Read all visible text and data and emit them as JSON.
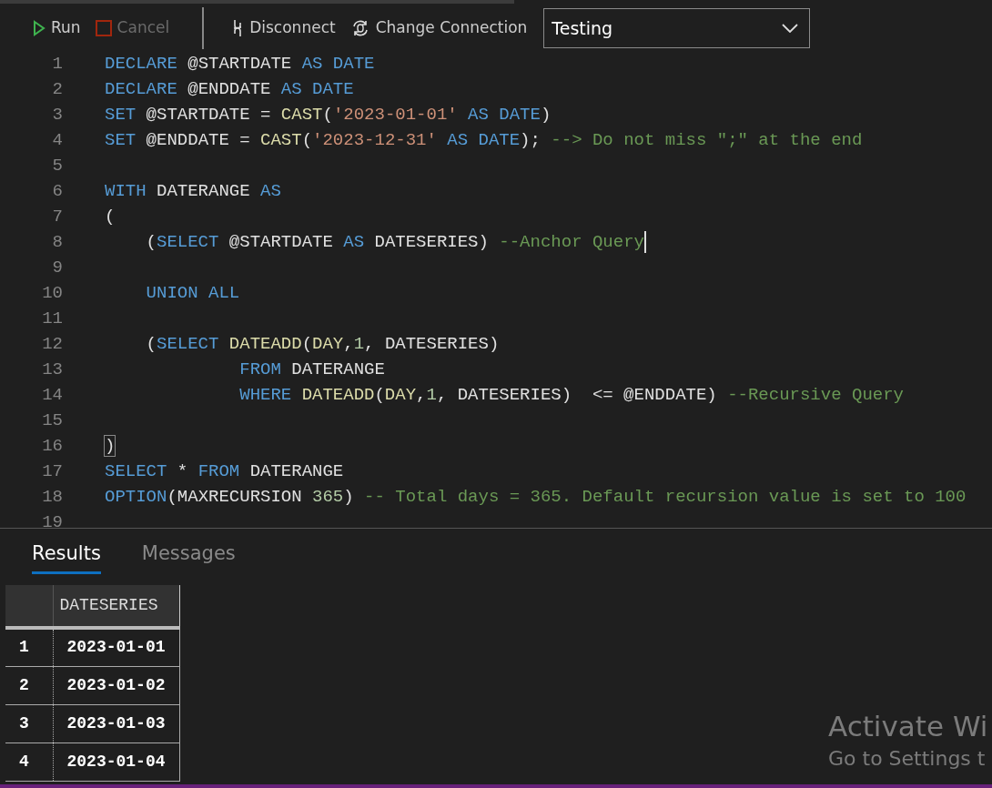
{
  "toolbar": {
    "buttons": [
      {
        "kind": "run",
        "label": "Run",
        "disabled": false
      },
      {
        "kind": "cancel",
        "label": "Cancel",
        "disabled": true
      },
      {
        "kind": "disconnect",
        "label": "Disconnect",
        "disabled": false
      },
      {
        "kind": "change",
        "label": "Change Connection",
        "disabled": false
      }
    ],
    "connection": {
      "value": "Testing"
    }
  },
  "editor": {
    "lines": [
      {
        "number": "1",
        "tokens": [
          {
            "kind": "kw",
            "text": "DECLARE"
          },
          {
            "kind": "txt",
            "text": " @STARTDATE "
          },
          {
            "kind": "kw",
            "text": "AS DATE"
          }
        ]
      },
      {
        "number": "2",
        "tokens": [
          {
            "kind": "kw",
            "text": "DECLARE"
          },
          {
            "kind": "txt",
            "text": " @ENDDATE "
          },
          {
            "kind": "kw",
            "text": "AS DATE"
          }
        ]
      },
      {
        "number": "3",
        "tokens": [
          {
            "kind": "kw",
            "text": "SET"
          },
          {
            "kind": "txt",
            "text": " @STARTDATE = "
          },
          {
            "kind": "fn",
            "text": "CAST"
          },
          {
            "kind": "txt",
            "text": "("
          },
          {
            "kind": "str",
            "text": "'2023-01-01'"
          },
          {
            "kind": "kw",
            "text": " AS DATE"
          },
          {
            "kind": "txt",
            "text": ")"
          }
        ]
      },
      {
        "number": "4",
        "tokens": [
          {
            "kind": "kw",
            "text": "SET"
          },
          {
            "kind": "txt",
            "text": " @ENDDATE = "
          },
          {
            "kind": "fn",
            "text": "CAST"
          },
          {
            "kind": "txt",
            "text": "("
          },
          {
            "kind": "str",
            "text": "'2023-12-31'"
          },
          {
            "kind": "kw",
            "text": " AS DATE"
          },
          {
            "kind": "txt",
            "text": "); "
          },
          {
            "kind": "cmt",
            "text": "--> Do not miss \";\" at the end"
          }
        ]
      },
      {
        "number": "5"
      },
      {
        "number": "6",
        "tokens": [
          {
            "kind": "kw",
            "text": "WITH"
          },
          {
            "kind": "txt",
            "text": " DATERANGE "
          },
          {
            "kind": "kw",
            "text": "AS"
          }
        ]
      },
      {
        "number": "7",
        "tokens": [
          {
            "kind": "txt",
            "text": "("
          }
        ]
      },
      {
        "number": "8",
        "cursor": true,
        "tokens": [
          {
            "kind": "txt",
            "text": "    ("
          },
          {
            "kind": "kw",
            "text": "SELECT"
          },
          {
            "kind": "txt",
            "text": " @STARTDATE "
          },
          {
            "kind": "kw",
            "text": "AS"
          },
          {
            "kind": "txt",
            "text": " DATESERIES) "
          },
          {
            "kind": "cmt",
            "text": "--Anchor Query"
          }
        ]
      },
      {
        "number": "9"
      },
      {
        "number": "10",
        "tokens": [
          {
            "kind": "kw",
            "text": "    UNION ALL"
          }
        ]
      },
      {
        "number": "11"
      },
      {
        "number": "12",
        "tokens": [
          {
            "kind": "txt",
            "text": "    ("
          },
          {
            "kind": "kw",
            "text": "SELECT"
          },
          {
            "kind": "fn",
            "text": " DATEADD"
          },
          {
            "kind": "txt",
            "text": "("
          },
          {
            "kind": "fn",
            "text": "DAY"
          },
          {
            "kind": "txt",
            "text": ","
          },
          {
            "kind": "num",
            "text": "1"
          },
          {
            "kind": "txt",
            "text": ", DATESERIES)"
          }
        ]
      },
      {
        "number": "13",
        "tokens": [
          {
            "kind": "kw",
            "text": "             FROM"
          },
          {
            "kind": "txt",
            "text": " DATERANGE"
          }
        ]
      },
      {
        "number": "14",
        "tokens": [
          {
            "kind": "kw",
            "text": "             WHERE"
          },
          {
            "kind": "fn",
            "text": " DATEADD"
          },
          {
            "kind": "txt",
            "text": "("
          },
          {
            "kind": "fn",
            "text": "DAY"
          },
          {
            "kind": "txt",
            "text": ","
          },
          {
            "kind": "num",
            "text": "1"
          },
          {
            "kind": "txt",
            "text": ", DATESERIES)  <= @ENDDATE) "
          },
          {
            "kind": "cmt",
            "text": "--Recursive Query"
          }
        ]
      },
      {
        "number": "15"
      },
      {
        "number": "16",
        "bracket_match": true,
        "tokens": [
          {
            "kind": "txt",
            "text": ")"
          }
        ]
      },
      {
        "number": "17",
        "tokens": [
          {
            "kind": "kw",
            "text": "SELECT"
          },
          {
            "kind": "txt",
            "text": " * "
          },
          {
            "kind": "kw",
            "text": "FROM"
          },
          {
            "kind": "txt",
            "text": " DATERANGE"
          }
        ]
      },
      {
        "number": "18",
        "tokens": [
          {
            "kind": "kw",
            "text": "OPTION"
          },
          {
            "kind": "txt",
            "text": "(MAXRECURSION "
          },
          {
            "kind": "num",
            "text": "365"
          },
          {
            "kind": "txt",
            "text": ") "
          },
          {
            "kind": "cmt",
            "text": "-- Total days = 365. Default recursion value is set to 100"
          }
        ]
      },
      {
        "number": "19"
      }
    ]
  },
  "results": {
    "tabs": [
      {
        "label": "Results",
        "selected": true
      },
      {
        "label": "Messages",
        "selected": false
      }
    ],
    "table": {
      "columns": [
        "DATESERIES"
      ],
      "rows": [
        {
          "number": "1",
          "cells": [
            "2023-01-01"
          ]
        },
        {
          "number": "2",
          "cells": [
            "2023-01-02"
          ]
        },
        {
          "number": "3",
          "cells": [
            "2023-01-03"
          ]
        },
        {
          "number": "4",
          "cells": [
            "2023-01-04"
          ]
        }
      ]
    }
  },
  "activation_notice": {
    "title": "Activate Wi",
    "subtitle": "Go to Settings t"
  }
}
